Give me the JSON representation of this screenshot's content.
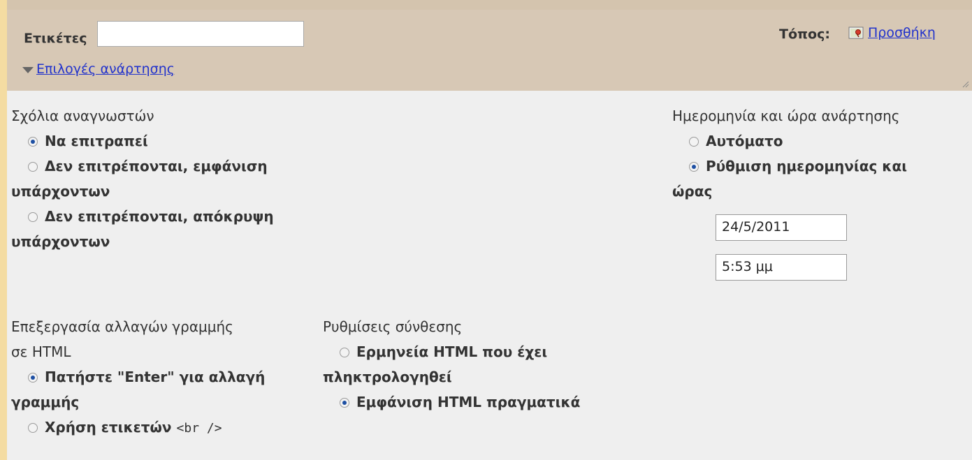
{
  "labels": {
    "tags": "Ετικέτες",
    "location": "Τόπος:",
    "add_location": "Προσθήκη",
    "post_options": "Επιλογές ανάρτησης"
  },
  "fields": {
    "tags_value": "",
    "date_value": "24/5/2011",
    "time_value": "5:53 μμ"
  },
  "reader_comments": {
    "title": "Σχόλια αναγνωστών",
    "options": [
      {
        "label_first": "Να επιτραπεί",
        "label_cont": "",
        "selected": true
      },
      {
        "label_first": "Δεν επιτρέπονται, εμφάνιση",
        "label_cont": "υπάρχοντων",
        "selected": false
      },
      {
        "label_first": "Δεν επιτρέπονται, απόκρυψη",
        "label_cont": "υπάρχοντων",
        "selected": false
      }
    ]
  },
  "post_date": {
    "title": "Ημερομηνία και ώρα ανάρτησης",
    "options": [
      {
        "label_first": "Αυτόματο",
        "label_cont": "",
        "selected": false
      },
      {
        "label_first": "Ρύθμιση ημερομηνίας και",
        "label_cont": "ώρας",
        "selected": true
      }
    ]
  },
  "line_breaks": {
    "title_first": "Επεξεργασία αλλαγών γραμμής",
    "title_cont": "σε HTML",
    "options": [
      {
        "label_first": "Πατήστε \"Enter\" για αλλαγή",
        "label_cont": "γραμμής",
        "selected": true
      },
      {
        "label_first": "Χρήση ετικετών",
        "tag": "<br />",
        "selected": false
      }
    ]
  },
  "compose": {
    "title": "Ρυθμίσεις σύνθεσης",
    "options": [
      {
        "label_first": "Ερμηνεία HTML που έχει",
        "label_cont": "πληκτρολογηθεί",
        "selected": false
      },
      {
        "label_first": "Εμφάνιση HTML πραγματικά",
        "label_cont": "",
        "selected": true
      }
    ]
  },
  "colors": {
    "panel_bg": "#d7c8b5",
    "link": "#2233cc",
    "left_stripe": "#f4dca2"
  }
}
